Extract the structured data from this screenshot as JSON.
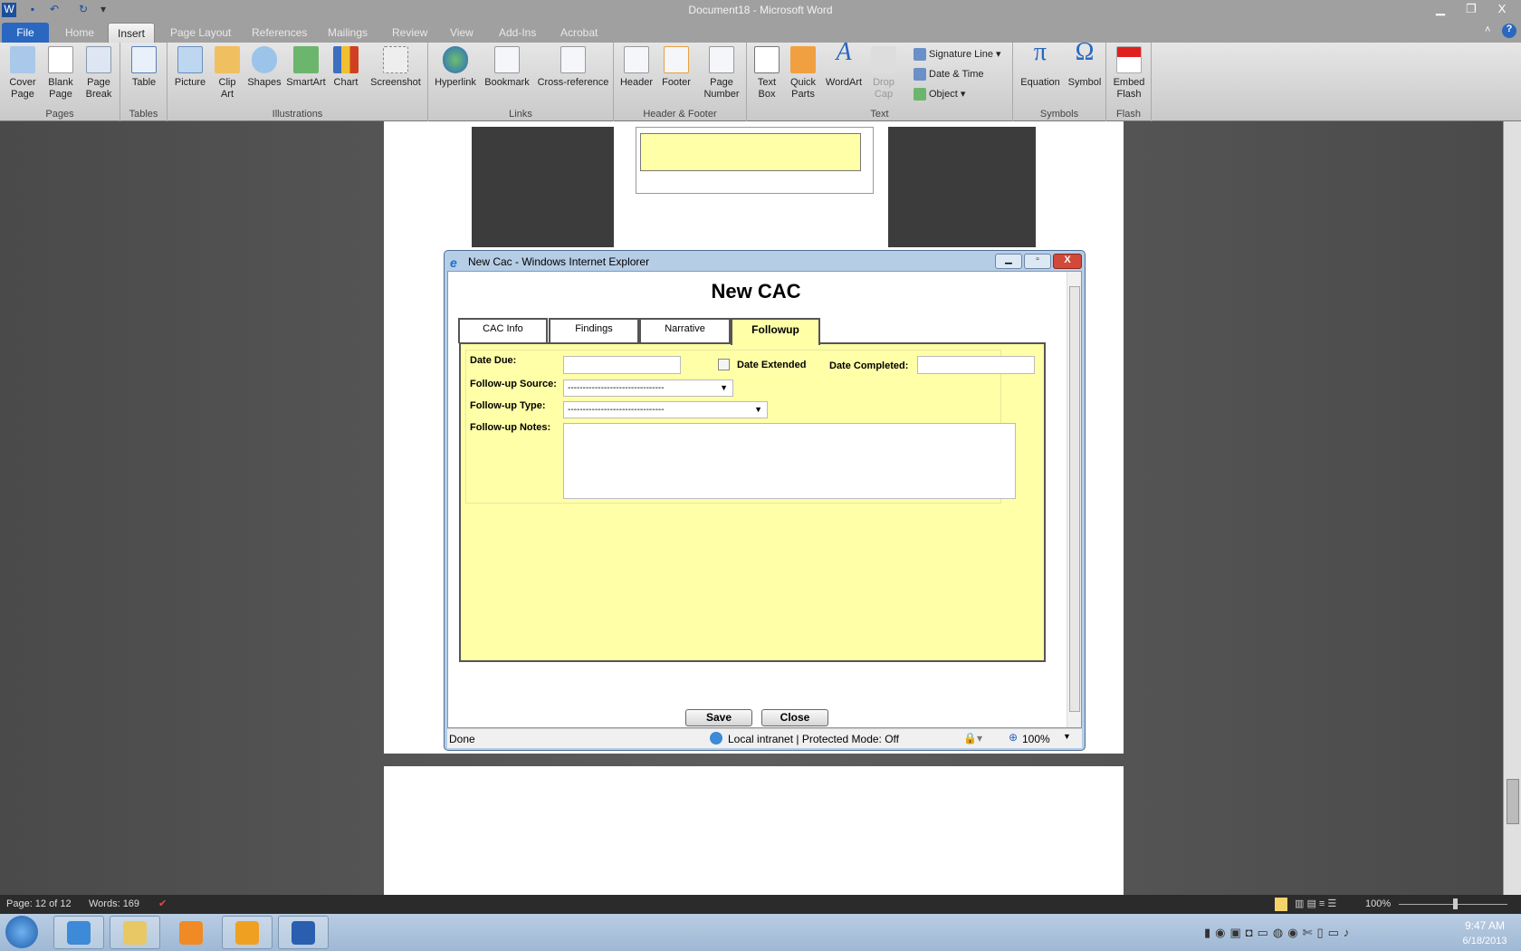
{
  "window": {
    "title": "Document18 - Microsoft Word",
    "minimize": "▁",
    "restore": "❐",
    "close": "X"
  },
  "ribbon_tabs": [
    "File",
    "Home",
    "Insert",
    "Page Layout",
    "References",
    "Mailings",
    "Review",
    "View",
    "Add-Ins",
    "Acrobat"
  ],
  "ribbon": {
    "pages": {
      "label": "Pages",
      "buttons": [
        "Cover Page",
        "Blank Page",
        "Page Break"
      ]
    },
    "tables": {
      "label": "Tables",
      "buttons": [
        "Table"
      ]
    },
    "illustrations": {
      "label": "Illustrations",
      "buttons": [
        "Picture",
        "Clip Art",
        "Shapes",
        "SmartArt",
        "Chart",
        "Screenshot"
      ]
    },
    "links": {
      "label": "Links",
      "buttons": [
        "Hyperlink",
        "Bookmark",
        "Cross-reference"
      ]
    },
    "header_footer": {
      "label": "Header & Footer",
      "buttons": [
        "Header",
        "Footer",
        "Page Number"
      ]
    },
    "text": {
      "label": "Text",
      "buttons": [
        "Text Box",
        "Quick Parts",
        "WordArt",
        "Drop Cap"
      ],
      "small": [
        "Signature Line",
        "Date & Time",
        "Object"
      ]
    },
    "symbols": {
      "label": "Symbols",
      "buttons": [
        "Equation",
        "Symbol"
      ]
    },
    "flash": {
      "label": "Flash",
      "buttons": [
        "Embed Flash"
      ]
    }
  },
  "ie": {
    "title": "New Cac - Windows Internet Explorer",
    "heading": "New CAC",
    "tabs": [
      "CAC Info",
      "Findings",
      "Narrative",
      "Followup"
    ],
    "form": {
      "date_due": "Date Due:",
      "date_extended": "Date Extended",
      "date_completed": "Date Completed:",
      "source": "Follow-up Source:",
      "type": "Follow-up Type:",
      "notes": "Follow-up Notes:",
      "source_value": "--------------------------------",
      "type_value": "--------------------------------"
    },
    "buttons": {
      "save": "Save",
      "close": "Close"
    },
    "status": {
      "done": "Done",
      "zone": "Local intranet | Protected Mode: Off",
      "zoom": "100%"
    }
  },
  "statusbar": {
    "page": "Page: 12 of 12",
    "words": "Words: 169",
    "zoom": "100%"
  },
  "taskbar": {
    "time": "9:47 AM",
    "date": "6/18/2013"
  },
  "colors": {
    "form_bg": "#ffffa8",
    "file_tab": "#2a67c0"
  }
}
